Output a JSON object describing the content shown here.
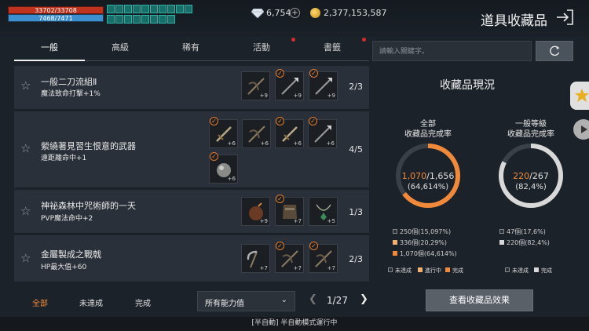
{
  "player": {
    "hp_text": "33702/33708",
    "mp_text": "7468/7471"
  },
  "currency": {
    "gems": "6,754",
    "gold": "2,377,153,587"
  },
  "page": {
    "title": "道具收藏品"
  },
  "tabs": [
    {
      "label": "一般",
      "active": true
    },
    {
      "label": "高級",
      "active": false
    },
    {
      "label": "稀有",
      "active": false
    },
    {
      "label": "活動",
      "active": false,
      "alert": true
    },
    {
      "label": "書籤",
      "active": false,
      "alert": true
    }
  ],
  "search": {
    "placeholder": "請輸入關鍵字。"
  },
  "collections": [
    {
      "name": "一般二刀流組Ⅱ",
      "bonus": "魔法致命打擊+1%",
      "count": "2/3",
      "items": [
        {
          "icon": "crossbow-icon",
          "level": "+9",
          "checked": false
        },
        {
          "icon": "spear-icon",
          "level": "+9",
          "checked": true
        },
        {
          "icon": "spear-icon",
          "level": "+9",
          "checked": true
        }
      ]
    },
    {
      "name": "縈繞著見習生恨意的武器",
      "bonus": "遠距離命中+1",
      "count": "4/5",
      "items": [
        {
          "icon": "sword-icon",
          "level": "+6",
          "checked": true
        },
        {
          "icon": "crossbow-icon",
          "level": "+6",
          "checked": false
        },
        {
          "icon": "sword-icon",
          "level": "+6",
          "checked": true
        },
        {
          "icon": "spear-icon",
          "level": "+6",
          "checked": true
        },
        {
          "icon": "orb-icon",
          "level": "+6",
          "checked": true
        }
      ]
    },
    {
      "name": "神祕森林中咒術師的一天",
      "bonus": "PVP魔法命中+2",
      "count": "1/3",
      "items": [
        {
          "icon": "bomb-icon",
          "level": "+9",
          "checked": false
        },
        {
          "icon": "armor-icon",
          "level": "+7",
          "checked": true
        },
        {
          "icon": "necklace-icon",
          "level": "+5",
          "checked": false
        }
      ]
    },
    {
      "name": "金屬製成之戰戟",
      "bonus": "HP最大值+60",
      "count": "2/3",
      "items": [
        {
          "icon": "scythe-icon",
          "level": "+7",
          "checked": false
        },
        {
          "icon": "crossbow-icon",
          "level": "+7",
          "checked": true
        },
        {
          "icon": "crossbow-icon",
          "level": "+7",
          "checked": true
        }
      ]
    }
  ],
  "filters": {
    "all": "全部",
    "incomplete": "未達成",
    "complete": "完成"
  },
  "ability_select": {
    "value": "所有能力值"
  },
  "pagination": {
    "text": "1/27"
  },
  "collection_status": {
    "title": "收藏品現況",
    "total": {
      "title_line1": "全部",
      "title_line2": "收藏品完成率",
      "done": "1,070",
      "total": "/1,656",
      "percent": "(64,614%)",
      "completion": 0.64614,
      "legend": [
        "250個(15,097%)",
        "336個(20,29%)",
        "1,070個(64,614%)"
      ]
    },
    "normal": {
      "title_line1": "一般等級",
      "title_line2": "收藏品完成率",
      "done": "220",
      "total": "/267",
      "percent": "(82,4%)",
      "completion": 0.824,
      "legend": [
        "47個(17,6%)",
        "220個(82,4%)"
      ]
    },
    "keys": {
      "incomplete": "未達成",
      "in_progress": "進行中",
      "complete": "完成"
    },
    "colors": {
      "complete": "#f08a3a",
      "in_progress": "#f0b070",
      "incomplete": "#2a3038",
      "ring_track": "#3a4048",
      "normal_ring": "#d8d8d8"
    }
  },
  "view_effects_button": "查看收藏品效果",
  "status": {
    "text": "[半自動] 半自動模式運行中"
  }
}
